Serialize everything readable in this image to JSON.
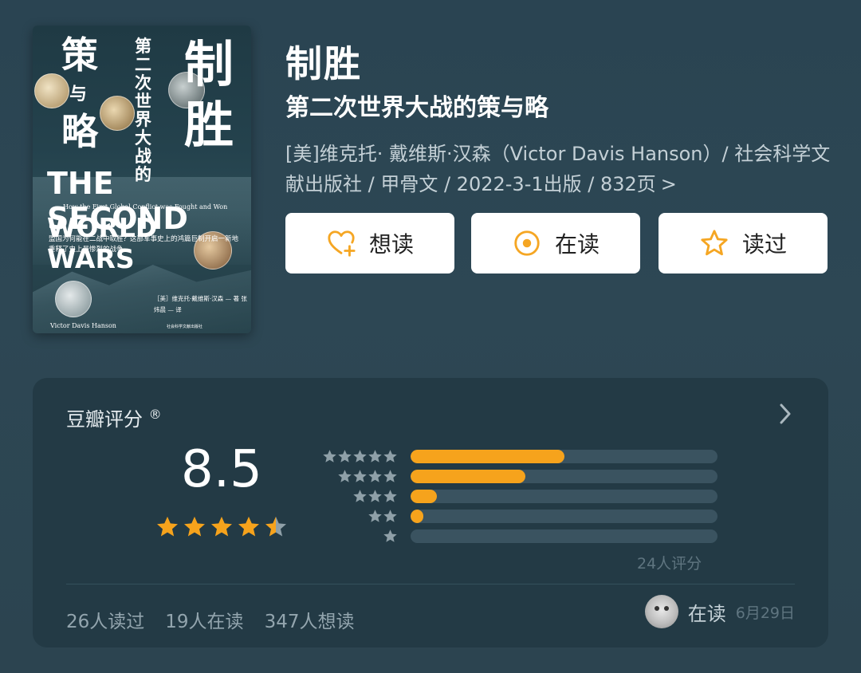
{
  "cover": {
    "zh_ce": "策",
    "zh_yu": "与",
    "zh_lue": "略",
    "zh_zhi": "制",
    "zh_sheng": "胜",
    "zh_vertical": "第二次世界大战的",
    "en_line1": "THE SECOND",
    "en_small": "How the First Global Conflict was Fought and Won",
    "en_line2": "WORLD WARS",
    "blurb": "盟国为何能在二战中取胜？这部军事史上的鸿篇巨制开启一新地重释了史上最惨烈的战争。",
    "author": "［美］维克托·戴维斯·汉森 — 著 张炜晨 — 译",
    "author_en": "Victor Davis Hanson",
    "publisher": "社会科学文献出版社"
  },
  "book": {
    "title": "制胜",
    "subtitle": "第二次世界大战的策与略",
    "meta": "[美]维克托· 戴维斯·汉森（Victor Davis Hanson）/ 社会科学文献出版社 / 甲骨文 / 2022-3-1出版 / 832页",
    "meta_chevron": ">"
  },
  "actions": {
    "want": "想读",
    "reading": "在读",
    "read": "读过"
  },
  "rating": {
    "title": "豆瓣评分",
    "title_mark": "®",
    "score": "8.5",
    "stars": 4.5,
    "total_text": "24人评分",
    "distribution": [
      {
        "stars": 5,
        "fraction": 0.5
      },
      {
        "stars": 4,
        "fraction": 0.375
      },
      {
        "stars": 3,
        "fraction": 0.085
      },
      {
        "stars": 2,
        "fraction": 0.042
      },
      {
        "stars": 1,
        "fraction": 0.0
      }
    ]
  },
  "stats": {
    "read_count": "26人读过",
    "reading_count": "19人在读",
    "want_count": "347人想读"
  },
  "reader": {
    "status": "在读",
    "date": "6月29日"
  },
  "colors": {
    "accent": "#f6a31c",
    "background": "#2b4552",
    "card": "#233a45",
    "bar_track": "#3a5360",
    "icon_orange": "#f5a623"
  }
}
